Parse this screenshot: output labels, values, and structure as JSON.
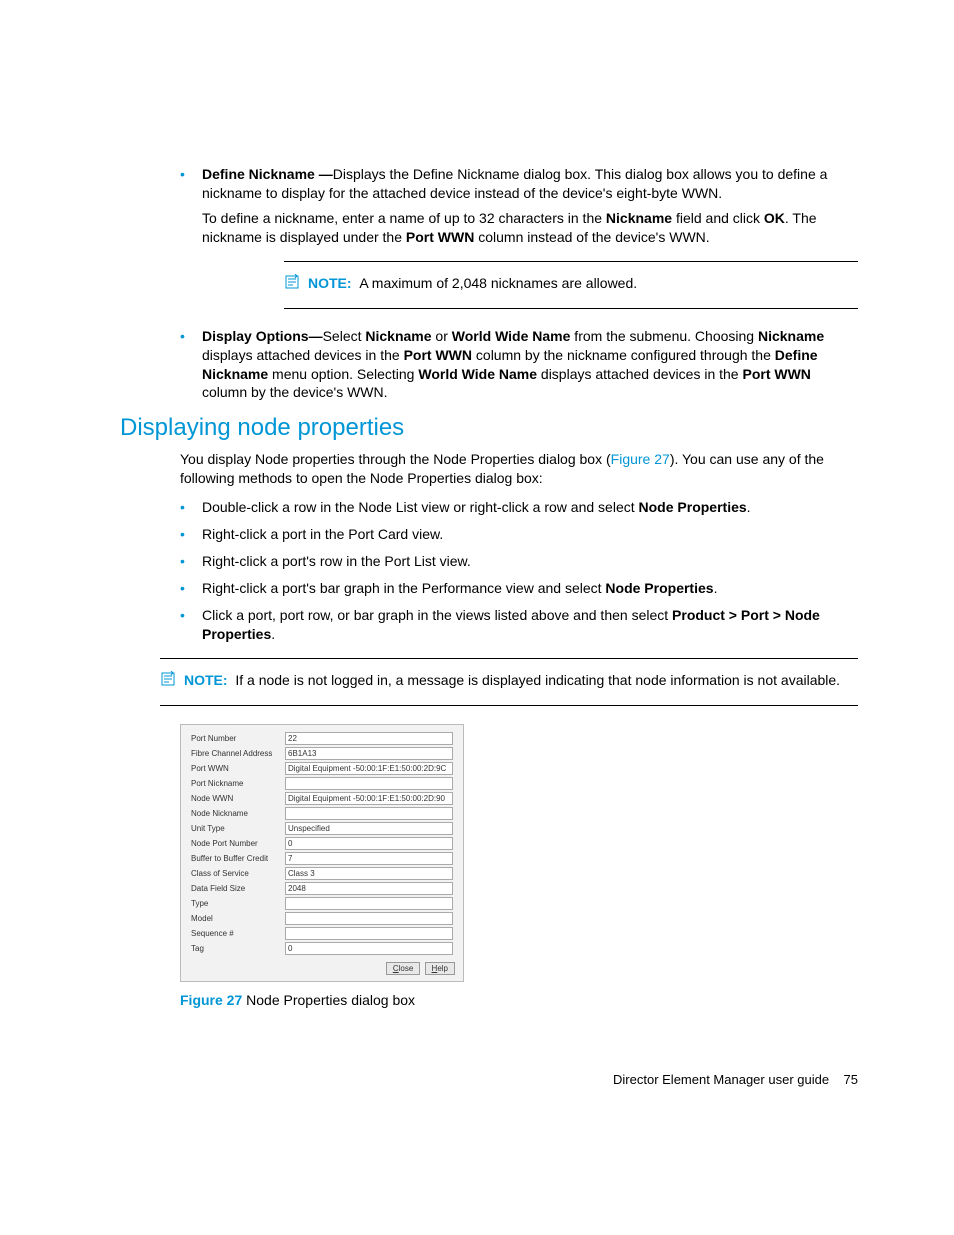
{
  "bullets1": {
    "item1": {
      "lead": "Define Nickname —",
      "rest": "Displays the Define Nickname dialog box. This dialog box allows you to define a nickname to display for the attached device instead of the device's eight-byte WWN.",
      "para2_a": "To define a nickname, enter a name of up to 32 characters in the ",
      "para2_b": "Nickname",
      "para2_c": " field and click ",
      "para2_d": "OK",
      "para2_e": ". The nickname is displayed under the ",
      "para2_f": "Port WWN",
      "para2_g": " column instead of the device's WWN."
    },
    "item2": {
      "lead": "Display Options—",
      "a": "Select ",
      "b": "Nickname",
      "c": " or ",
      "d": "World Wide Name",
      "e": " from the submenu. Choosing ",
      "f": "Nickname",
      "g": " displays attached devices in the ",
      "h": "Port WWN",
      "i": " column by the nickname configured through the ",
      "j": "Define Nickname",
      "k": " menu option. Selecting ",
      "l": "World Wide Name",
      "m": " displays attached devices in the ",
      "n": "Port WWN",
      "o": " column by the device's WWN."
    }
  },
  "note1": {
    "label": "NOTE:",
    "text": "A maximum of 2,048 nicknames are allowed."
  },
  "heading": "Displaying node properties",
  "intro": {
    "a": "You display Node properties through the Node Properties dialog box (",
    "link": "Figure 27",
    "b": "). You can use any of the following methods to open the Node Properties dialog box:"
  },
  "bullets2": {
    "i1a": "Double-click a row in the Node List view or right-click a row and select ",
    "i1b": "Node Properties",
    "i1c": ".",
    "i2": "Right-click a port in the Port Card view.",
    "i3": "Right-click a port's row in the Port List view.",
    "i4a": "Right-click a port's bar graph in the Performance view and select ",
    "i4b": "Node Properties",
    "i4c": ".",
    "i5a": "Click a port, port row, or bar graph in the views listed above and then select ",
    "i5b": "Product > Port > Node Properties",
    "i5c": "."
  },
  "note2": {
    "label": "NOTE:",
    "text": "If a node is not logged in, a message is displayed indicating that node information is not available."
  },
  "dialog": {
    "rows": {
      "r0l": "Port Number",
      "r0v": "22",
      "r1l": "Fibre Channel Address",
      "r1v": "6B1A13",
      "r2l": "Port WWN",
      "r2v": "Digital Equipment -50:00:1F:E1:50:00:2D:9C",
      "r3l": "Port Nickname",
      "r3v": "",
      "r4l": "Node WWN",
      "r4v": "Digital Equipment -50:00:1F:E1:50:00:2D:90",
      "r5l": "Node Nickname",
      "r5v": "",
      "r6l": "Unit Type",
      "r6v": "Unspecified",
      "r7l": "Node Port Number",
      "r7v": "0",
      "r8l": "Buffer to Buffer Credit",
      "r8v": "7",
      "r9l": "Class of Service",
      "r9v": "Class 3",
      "r10l": "Data Field Size",
      "r10v": "2048",
      "r11l": "Type",
      "r11v": "",
      "r12l": "Model",
      "r12v": "",
      "r13l": "Sequence #",
      "r13v": "",
      "r14l": "Tag",
      "r14v": "0"
    },
    "btnClose_u": "C",
    "btnClose_r": "lose",
    "btnHelp_u": "H",
    "btnHelp_r": "elp"
  },
  "figcap": {
    "num": "Figure 27",
    "text": " Node Properties dialog box"
  },
  "footer": {
    "title": "Director Element Manager user guide",
    "page": "75"
  }
}
